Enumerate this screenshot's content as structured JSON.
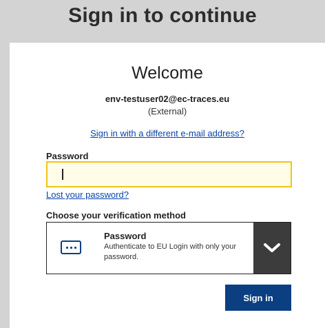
{
  "header": {
    "title": "Sign in to continue"
  },
  "login": {
    "welcome": "Welcome",
    "email": "env-testuser02@ec-traces.eu",
    "account_type": "(External)",
    "different_email_link": "Sign in with a different e-mail address?",
    "password_label": "Password",
    "password_value": "",
    "lost_password_link": "Lost your password?",
    "method_label": "Choose your verification method",
    "method": {
      "icon": "password-dots-icon",
      "title": "Password",
      "description": "Authenticate to EU Login with only your password.",
      "toggle_icon": "chevron-down-icon"
    },
    "signin_button": "Sign in"
  },
  "colors": {
    "background": "#d3d3d3",
    "card": "#ffffff",
    "link": "#0645ad",
    "primary": "#0b3f82",
    "input_border": "#f0c419",
    "toggle": "#3c3c3c"
  }
}
